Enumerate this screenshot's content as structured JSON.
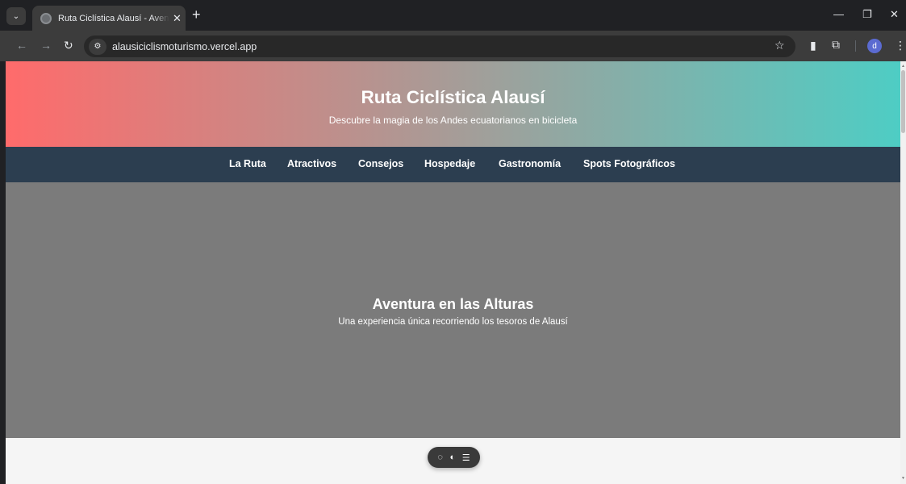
{
  "browser": {
    "tab_title": "Ruta Ciclística Alausí - Aventura",
    "tab_close": "✕",
    "new_tab": "+",
    "url": "alausiciclismoturismo.vercel.app",
    "profile_initial": "d",
    "icons": [
      "tab-menu-icon",
      "favicon-icon",
      "back-icon",
      "forward-icon",
      "reload-icon",
      "site-info-icon",
      "star-icon",
      "reading-list-icon",
      "extensions-icon",
      "menu-dots-icon",
      "minimize-icon",
      "restore-icon",
      "close-window-icon"
    ]
  },
  "header": {
    "title": "Ruta Ciclística Alausí",
    "subtitle": "Descubre la magia de los Andes ecuatorianos en bicicleta",
    "gradient_colors": [
      "#ff6b6b",
      "#4ecdc4"
    ]
  },
  "nav": {
    "items": [
      {
        "label": "La Ruta"
      },
      {
        "label": "Atractivos"
      },
      {
        "label": "Consejos"
      },
      {
        "label": "Hospedaje"
      },
      {
        "label": "Gastronomía"
      },
      {
        "label": "Spots Fotográficos"
      }
    ],
    "background": "#2c3e50"
  },
  "banner": {
    "title": "Aventura en las Alturas",
    "subtitle": "Una experiencia única recorriendo los tesoros de Alausí",
    "background": "#7b7b7b"
  },
  "floating_toolbar": {
    "icons": [
      "chat-icon",
      "toggle-icon",
      "list-icon"
    ]
  }
}
